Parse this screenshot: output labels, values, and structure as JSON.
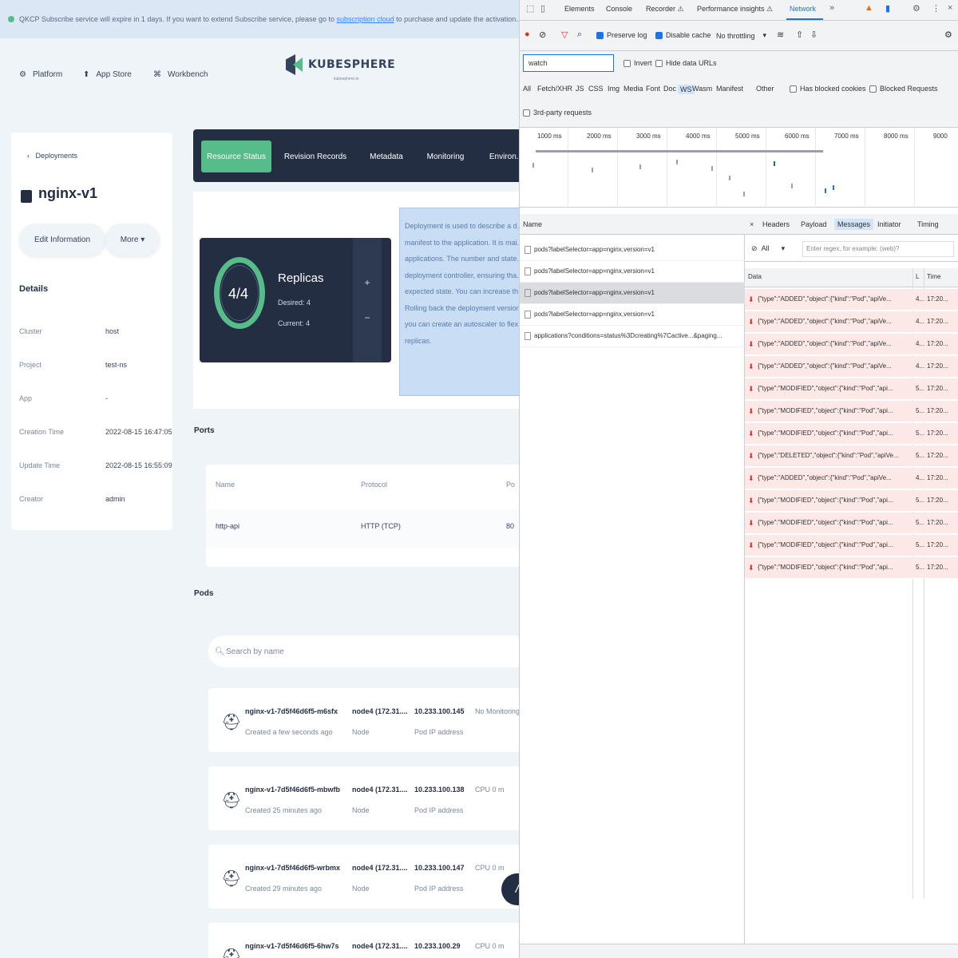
{
  "console": {
    "banner": {
      "text": "QKCP Subscribe service will expire in 1 days. If you want to extend Subscribe service, please go to",
      "link": "subscription cloud",
      "tail": "to purchase and update the activation..."
    },
    "nav": {
      "platform": "Platform",
      "app_store": "App Store",
      "workbench": "Workbench"
    },
    "logo": {
      "wordmark": "KUBESPHERE",
      "sub": "kubesphere.io"
    },
    "detail": {
      "back": "Deployments",
      "name": "nginx-v1",
      "edit_btn": "Edit Information",
      "more_btn": "More ▾",
      "details_title": "Details",
      "fields": [
        {
          "k": "Cluster",
          "v": "host"
        },
        {
          "k": "Project",
          "v": "test-ns"
        },
        {
          "k": "App",
          "v": "-"
        },
        {
          "k": "Creation Time",
          "v": "2022-08-15 16:47:05"
        },
        {
          "k": "Update Time",
          "v": "2022-08-15 16:55:09"
        },
        {
          "k": "Creator",
          "v": "admin"
        }
      ]
    },
    "tabs": [
      "Resource Status",
      "Revision Records",
      "Metadata",
      "Monitoring",
      "Environ..."
    ],
    "replicas": {
      "value": "4/4",
      "title": "Replicas",
      "desired": "Desired: 4",
      "current": "Current: 4",
      "plus": "+",
      "minus": "−"
    },
    "info_lines": [
      "Deployment is used to describe a d...",
      "manifest to the application. It is mai...",
      "applications. The number and state...",
      "deployment controller, ensuring tha...",
      "expected state. You can increase th...",
      "Rolling back the deployment version...",
      "you can create an autoscaler to flex...",
      "replicas."
    ],
    "ports": {
      "title": "Ports",
      "headers": [
        "Name",
        "Protocol",
        "Po"
      ],
      "row": [
        "http-api",
        "HTTP (TCP)",
        "80"
      ]
    },
    "pods": {
      "title": "Pods",
      "search_placeholder": "Search by name",
      "rows": [
        {
          "name": "nginx-v1-7d5f46d6f5-m6sfx",
          "time": "Created a few seconds ago",
          "node": "node4 (172.31....",
          "node_label": "Node",
          "ip": "10.233.100.145",
          "ip_label": "Pod IP address",
          "extra": "No Monitoring"
        },
        {
          "name": "nginx-v1-7d5f46d6f5-mbwfb",
          "time": "Created 25 minutes ago",
          "node": "node4 (172.31....",
          "node_label": "Node",
          "ip": "10.233.100.138",
          "ip_label": "Pod IP address",
          "extra": "CPU 0 m"
        },
        {
          "name": "nginx-v1-7d5f46d6f5-wrbmx",
          "time": "Created 29 minutes ago",
          "node": "node4 (172.31....",
          "node_label": "Node",
          "ip": "10.233.100.147",
          "ip_label": "Pod IP address",
          "extra": "CPU 0 m"
        },
        {
          "name": "nginx-v1-7d5f46d6f5-6hw7s",
          "time": "",
          "node": "node4 (172.31....",
          "node_label": "",
          "ip": "10.233.100.29",
          "ip_label": "",
          "extra": "CPU 0 m"
        }
      ]
    },
    "fab": "/"
  },
  "devtools": {
    "tabs": [
      "Elements",
      "Console",
      "Recorder ⚠",
      "Performance insights ⚠",
      "Network"
    ],
    "toolbar": {
      "preserve_log": "Preserve log",
      "disable_cache": "Disable cache",
      "throttle": "No throttling"
    },
    "filter": {
      "value": "watch",
      "invert": "Invert",
      "hide_data": "Hide data URLs"
    },
    "types": [
      "All",
      "Fetch/XHR",
      "JS",
      "CSS",
      "Img",
      "Media",
      "Font",
      "Doc",
      "WS",
      "Wasm",
      "Manifest",
      "Other"
    ],
    "blocked_cookies": "Has blocked cookies",
    "blocked_requests": "Blocked Requests",
    "third_party": "3rd-party requests",
    "ticks": [
      "1000 ms",
      "2000 ms",
      "3000 ms",
      "4000 ms",
      "5000 ms",
      "6000 ms",
      "7000 ms",
      "8000 ms",
      "9000"
    ],
    "req_header": "Name",
    "requests": [
      "pods?labelSelector=app=nginx,version=v1",
      "pods?labelSelector=app=nginx,version=v1",
      "pods?labelSelector=app=nginx,version=v1",
      "pods?labelSelector=app=nginx,version=v1",
      "applications?conditions=status%3Dcreating%7Cactive...&paging..."
    ],
    "detail_tabs": [
      "×",
      "Headers",
      "Payload",
      "Messages",
      "Initiator",
      "Timing"
    ],
    "msg_filter": {
      "select": "All",
      "placeholder": "Enter regex, for example: (web)?"
    },
    "msg_head": {
      "data": "Data",
      "len": "L",
      "time": "Time"
    },
    "messages": [
      {
        "text": "{\"type\":\"ADDED\",\"object\":{\"kind\":\"Pod\",\"apiVe...",
        "len": "4...",
        "time": "17:20..."
      },
      {
        "text": "{\"type\":\"ADDED\",\"object\":{\"kind\":\"Pod\",\"apiVe...",
        "len": "4...",
        "time": "17:20..."
      },
      {
        "text": "{\"type\":\"ADDED\",\"object\":{\"kind\":\"Pod\",\"apiVe...",
        "len": "4...",
        "time": "17:20..."
      },
      {
        "text": "{\"type\":\"ADDED\",\"object\":{\"kind\":\"Pod\",\"apiVe...",
        "len": "4...",
        "time": "17:20..."
      },
      {
        "text": "{\"type\":\"MODIFIED\",\"object\":{\"kind\":\"Pod\",\"api...",
        "len": "5...",
        "time": "17:20..."
      },
      {
        "text": "{\"type\":\"MODIFIED\",\"object\":{\"kind\":\"Pod\",\"api...",
        "len": "5...",
        "time": "17:20..."
      },
      {
        "text": "{\"type\":\"MODIFIED\",\"object\":{\"kind\":\"Pod\",\"api...",
        "len": "5...",
        "time": "17:20..."
      },
      {
        "text": "{\"type\":\"DELETED\",\"object\":{\"kind\":\"Pod\",\"apiVe...",
        "len": "5...",
        "time": "17:20..."
      },
      {
        "text": "{\"type\":\"ADDED\",\"object\":{\"kind\":\"Pod\",\"apiVe...",
        "len": "4...",
        "time": "17:20..."
      },
      {
        "text": "{\"type\":\"MODIFIED\",\"object\":{\"kind\":\"Pod\",\"api...",
        "len": "5...",
        "time": "17:20..."
      },
      {
        "text": "{\"type\":\"MODIFIED\",\"object\":{\"kind\":\"Pod\",\"api...",
        "len": "5...",
        "time": "17:20..."
      },
      {
        "text": "{\"type\":\"MODIFIED\",\"object\":{\"kind\":\"Pod\",\"api...",
        "len": "5...",
        "time": "17:20..."
      },
      {
        "text": "{\"type\":\"MODIFIED\",\"object\":{\"kind\":\"Pod\",\"api...",
        "len": "5...",
        "time": "17:20..."
      }
    ]
  }
}
